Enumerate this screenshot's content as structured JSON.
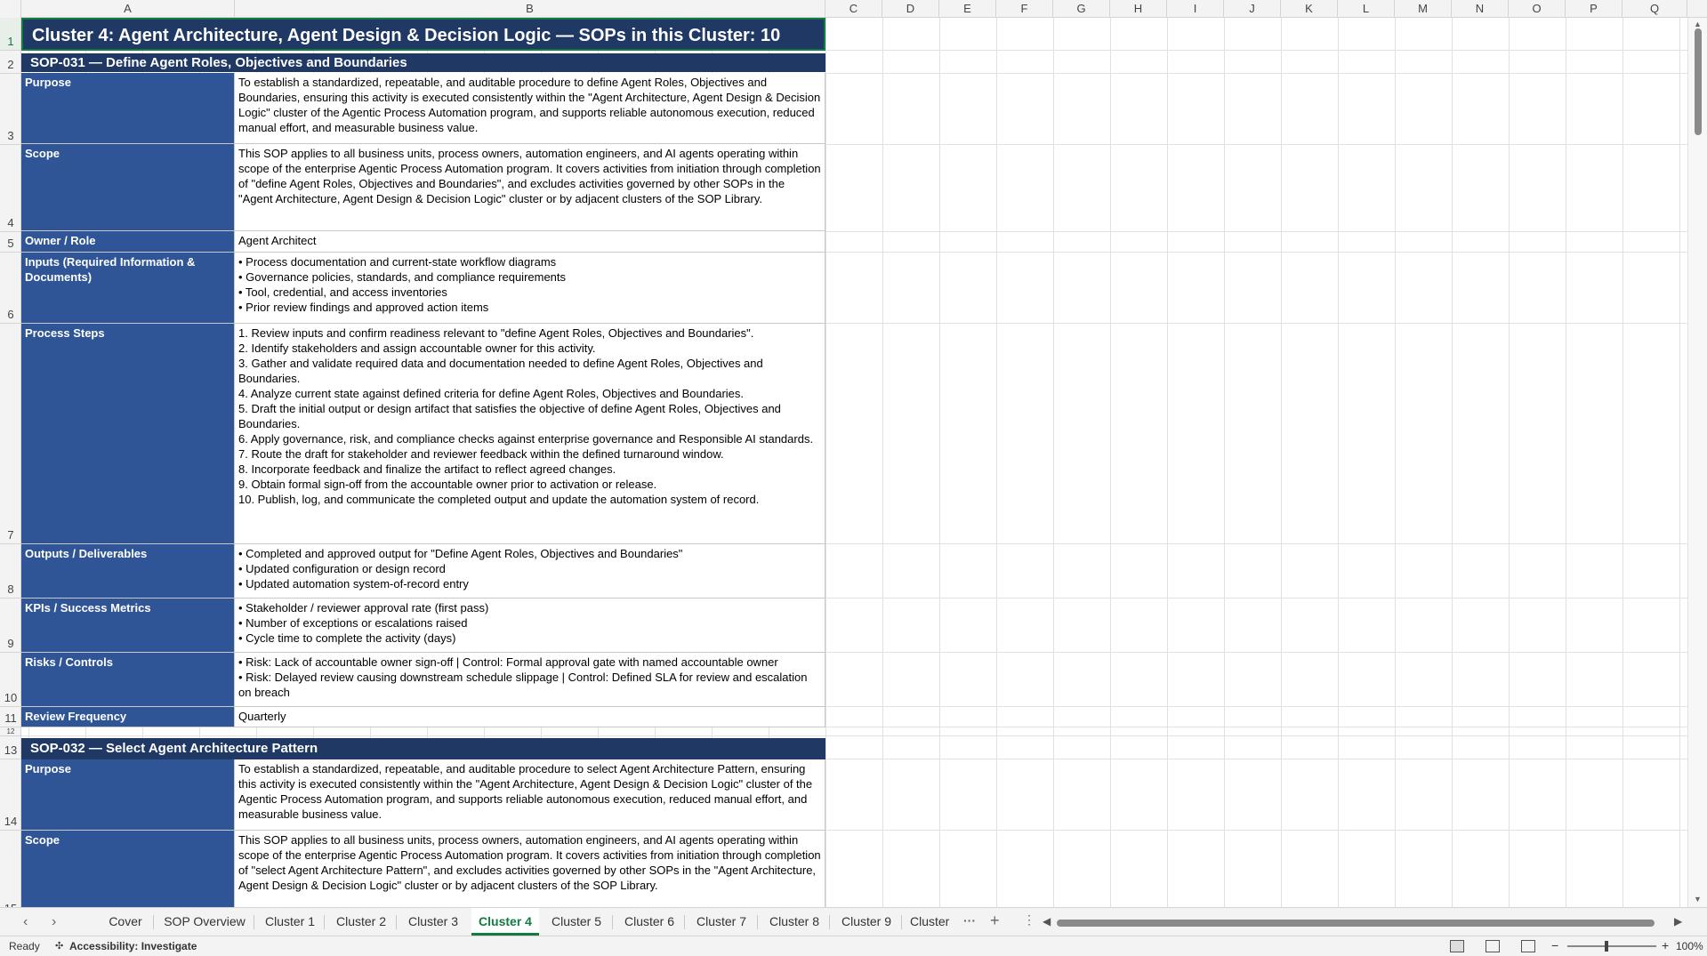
{
  "columns": [
    "A",
    "B",
    "C",
    "D",
    "E",
    "F",
    "G",
    "H",
    "I",
    "J",
    "K",
    "L",
    "M",
    "N",
    "O",
    "P",
    "Q"
  ],
  "rows": [
    "1",
    "2",
    "3",
    "4",
    "5",
    "6",
    "7",
    "8",
    "9",
    "10",
    "11",
    "12",
    "13",
    "14",
    "15"
  ],
  "title": "Cluster 4: Agent Architecture, Agent Design & Decision Logic  —  SOPs in this Cluster: 10",
  "sop31": {
    "header": "SOP-031  —  Define Agent Roles, Objectives and Boundaries",
    "purpose_label": "Purpose",
    "purpose": "To establish a standardized, repeatable, and auditable procedure to define Agent Roles, Objectives and Boundaries, ensuring this activity is executed consistently within the \"Agent Architecture, Agent Design & Decision Logic\" cluster of the Agentic Process Automation program, and supports reliable autonomous execution, reduced manual effort, and measurable business value.",
    "scope_label": "Scope",
    "scope": "This SOP applies to all business units, process owners, automation engineers, and AI agents operating within scope of the enterprise Agentic Process Automation program. It covers activities from initiation through completion of \"define Agent Roles, Objectives and Boundaries\", and excludes activities governed by other SOPs in the \"Agent Architecture, Agent Design & Decision Logic\" cluster or by adjacent clusters of the SOP Library.",
    "owner_label": "Owner / Role",
    "owner": "Agent Architect",
    "inputs_label": "Inputs (Required Information & Documents)",
    "inputs": "• Process documentation and current-state workflow diagrams\n• Governance policies, standards, and compliance requirements\n• Tool, credential, and access inventories\n• Prior review findings and approved action items",
    "steps_label": "Process Steps",
    "steps": "1. Review inputs and confirm readiness relevant to \"define Agent Roles, Objectives and Boundaries\".\n2. Identify stakeholders and assign accountable owner for this activity.\n3. Gather and validate required data and documentation needed to define Agent Roles, Objectives and Boundaries.\n4. Analyze current state against defined criteria for define Agent Roles, Objectives and Boundaries.\n5. Draft the initial output or design artifact that satisfies the objective of define Agent Roles, Objectives and Boundaries.\n6. Apply governance, risk, and compliance checks against enterprise governance and Responsible AI standards.\n7. Route the draft for stakeholder and reviewer feedback within the defined turnaround window.\n8. Incorporate feedback and finalize the artifact to reflect agreed changes.\n9. Obtain formal sign-off from the accountable owner prior to activation or release.\n10. Publish, log, and communicate the completed output and update the automation system of record.",
    "outputs_label": "Outputs / Deliverables",
    "outputs": "• Completed and approved output for \"Define Agent Roles, Objectives and Boundaries\"\n• Updated configuration or design record\n• Updated automation system-of-record entry",
    "kpis_label": "KPIs / Success Metrics",
    "kpis": "• Stakeholder / reviewer approval rate (first pass)\n• Number of exceptions or escalations raised\n• Cycle time to complete the activity (days)",
    "risks_label": "Risks / Controls",
    "risks": "• Risk: Lack of accountable owner sign-off | Control: Formal approval gate with named accountable owner\n• Risk: Delayed review causing downstream schedule slippage | Control: Defined SLA for review and escalation on breach",
    "freq_label": "Review Frequency",
    "freq": "Quarterly"
  },
  "sop32": {
    "header": "SOP-032  —  Select Agent Architecture Pattern",
    "purpose_label": "Purpose",
    "purpose": "To establish a standardized, repeatable, and auditable procedure to select Agent Architecture Pattern, ensuring this activity is executed consistently within the \"Agent Architecture, Agent Design & Decision Logic\" cluster of the Agentic Process Automation program, and supports reliable autonomous execution, reduced manual effort, and measurable business value.",
    "scope_label": "Scope",
    "scope": "This SOP applies to all business units, process owners, automation engineers, and AI agents operating within scope of the enterprise Agentic Process Automation program. It covers activities from initiation through completion of \"select Agent Architecture Pattern\", and excludes activities governed by other SOPs in the \"Agent Architecture, Agent Design & Decision Logic\" cluster or by adjacent clusters of the SOP Library."
  },
  "tabs": [
    "Cover",
    "SOP Overview",
    "Cluster 1",
    "Cluster 2",
    "Cluster 3",
    "Cluster 4",
    "Cluster 5",
    "Cluster 6",
    "Cluster 7",
    "Cluster 8",
    "Cluster 9",
    "Cluster"
  ],
  "active_tab": "Cluster 4",
  "status": {
    "ready": "Ready",
    "accessibility": "Accessibility: Investigate",
    "zoom": "100%"
  }
}
